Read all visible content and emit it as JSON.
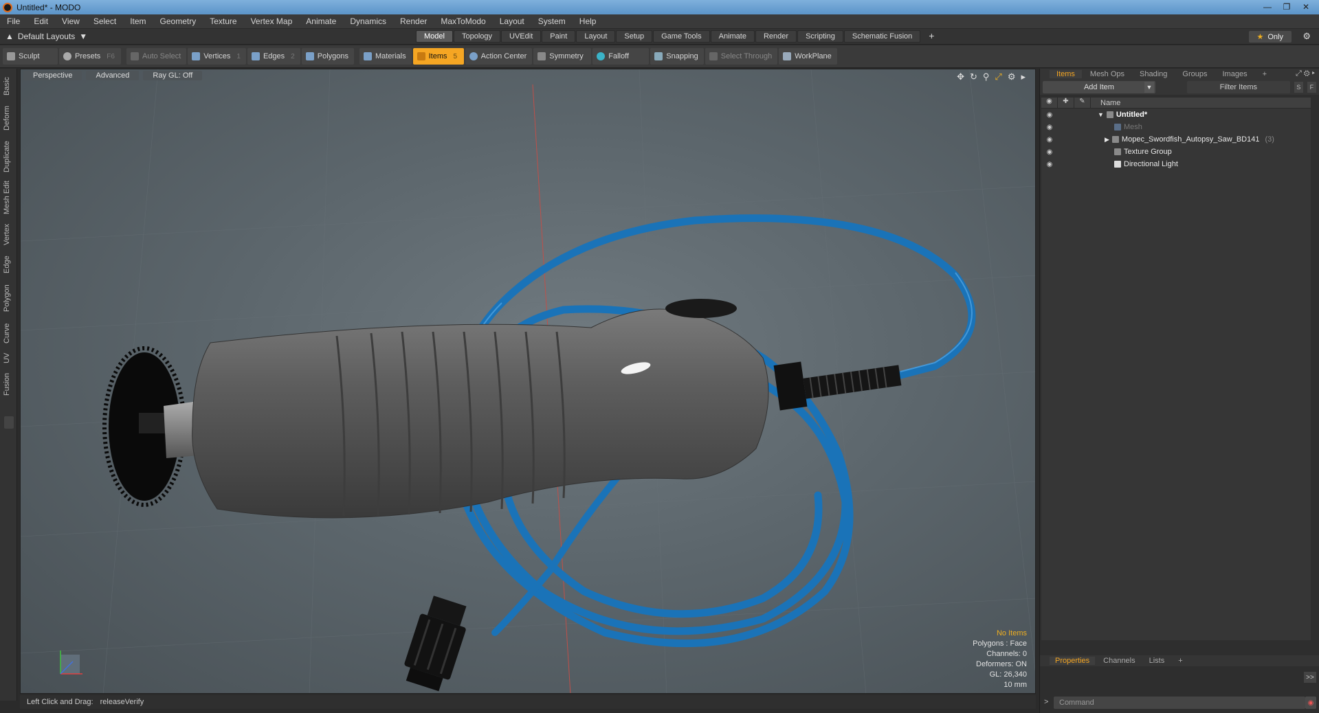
{
  "window": {
    "title": "Untitled* - MODO"
  },
  "menu": [
    "File",
    "Edit",
    "View",
    "Select",
    "Item",
    "Geometry",
    "Texture",
    "Vertex Map",
    "Animate",
    "Dynamics",
    "Render",
    "MaxToModo",
    "Layout",
    "System",
    "Help"
  ],
  "layout_select": "Default Layouts",
  "layout_tabs": [
    "Model",
    "Topology",
    "UVEdit",
    "Paint",
    "Layout",
    "Setup",
    "Game Tools",
    "Animate",
    "Render",
    "Scripting",
    "Schematic Fusion"
  ],
  "active_layout_tab": "Model",
  "only_label": "Only",
  "toolbar": {
    "sculpt": "Sculpt",
    "presets": "Presets",
    "presets_key": "F6",
    "auto_select": "Auto Select",
    "vertices": "Vertices",
    "vertices_key": "1",
    "edges": "Edges",
    "edges_key": "2",
    "polygons": "Polygons",
    "materials": "Materials",
    "items": "Items",
    "items_key": "5",
    "action_center": "Action Center",
    "symmetry": "Symmetry",
    "falloff": "Falloff",
    "snapping": "Snapping",
    "select_through": "Select Through",
    "workplane": "WorkPlane"
  },
  "left_tabs": [
    "Basic",
    "Deform",
    "Duplicate",
    "Mesh Edit",
    "Vertex",
    "Edge",
    "Polygon",
    "Curve",
    "UV",
    "Fusion"
  ],
  "viewport": {
    "view_mode": "Perspective",
    "shading": "Advanced",
    "raygl": "Ray GL: Off",
    "stats": [
      "No Items",
      "Polygons : Face",
      "Channels: 0",
      "Deformers: ON",
      "GL: 26,340",
      "10 mm"
    ]
  },
  "status": {
    "hint_label": "Left Click and Drag:",
    "hint_value": "releaseVerify"
  },
  "panel_tabs": [
    "Items",
    "Mesh Ops",
    "Shading",
    "Groups",
    "Images"
  ],
  "active_panel_tab": "Items",
  "add_item": "Add Item",
  "filter_items": "Filter Items",
  "tree_header": "Name",
  "tree": [
    {
      "label": "Untitled*",
      "bold": true,
      "dim": false,
      "count": ""
    },
    {
      "label": "Mesh",
      "bold": false,
      "dim": true,
      "count": ""
    },
    {
      "label": "Mopec_Swordfish_Autopsy_Saw_BD141",
      "bold": false,
      "dim": false,
      "count": "(3)"
    },
    {
      "label": "Texture Group",
      "bold": false,
      "dim": false,
      "count": ""
    },
    {
      "label": "Directional Light",
      "bold": false,
      "dim": false,
      "count": ""
    }
  ],
  "bottom_tabs": [
    "Properties",
    "Channels",
    "Lists"
  ],
  "active_bottom_tab": "Properties",
  "command_placeholder": "Command",
  "colors": {
    "accent": "#f5a623",
    "hose": "#1a73b8",
    "body": "#5a5a5a"
  }
}
